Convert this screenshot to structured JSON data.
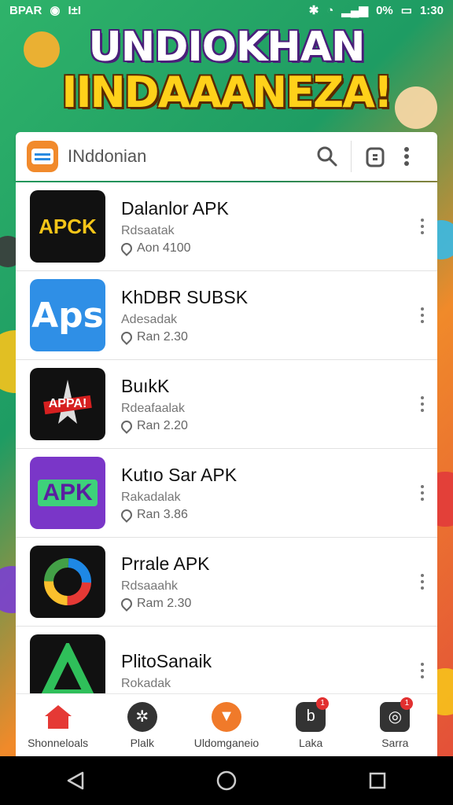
{
  "status_bar": {
    "carrier": "BPAR",
    "extra": "I±I",
    "battery": "0%",
    "time": "1:30"
  },
  "banner": {
    "line1": "UNDIOKHAN",
    "line2": "IINDAAANEZA!"
  },
  "search": {
    "value": "INddonian"
  },
  "apps": [
    {
      "title": "Dalanlor APK",
      "subtitle": "Rdsaatak",
      "meta": "Aon 4100",
      "icon": "apk-logo-icon",
      "icon_text": "APCK"
    },
    {
      "title": "KhDBR SUBSK",
      "subtitle": "Adesadak",
      "meta": "Ran 2.30",
      "icon": "apps-icon",
      "icon_text": "Aps"
    },
    {
      "title": "BuıkK",
      "subtitle": "Rdeafaalak",
      "meta": "Ran 2.20",
      "icon": "star-logo-icon",
      "icon_text": "APPA!"
    },
    {
      "title": "Kutıo Sar APK",
      "subtitle": "Rakadalak",
      "meta": "Ran 3.86",
      "icon": "apk-purple-icon",
      "icon_text": "APK"
    },
    {
      "title": "Prrale APK",
      "subtitle": "Rdsaaahk",
      "meta": "Ram 2.30",
      "icon": "ring-logo-icon",
      "icon_text": ""
    },
    {
      "title": "PlitoSanaik",
      "subtitle": "Rokadak",
      "meta": "",
      "icon": "triangle-logo-icon",
      "icon_text": ""
    }
  ],
  "bottom_nav": [
    {
      "label": "Shonneloals",
      "icon": "home-icon",
      "color": "#e53935",
      "badge": ""
    },
    {
      "label": "Plalk",
      "icon": "gamepad-icon",
      "color": "#333333",
      "badge": ""
    },
    {
      "label": "Uldomganeio",
      "icon": "cat-icon",
      "color": "#f07a2a",
      "badge": ""
    },
    {
      "label": "Laka",
      "icon": "chat-icon",
      "color": "#333333",
      "badge": "1"
    },
    {
      "label": "Sarra",
      "icon": "camera-icon",
      "color": "#333333",
      "badge": "1"
    }
  ],
  "colors": {
    "accent": "#f18a2c",
    "badge": "#e23030"
  }
}
